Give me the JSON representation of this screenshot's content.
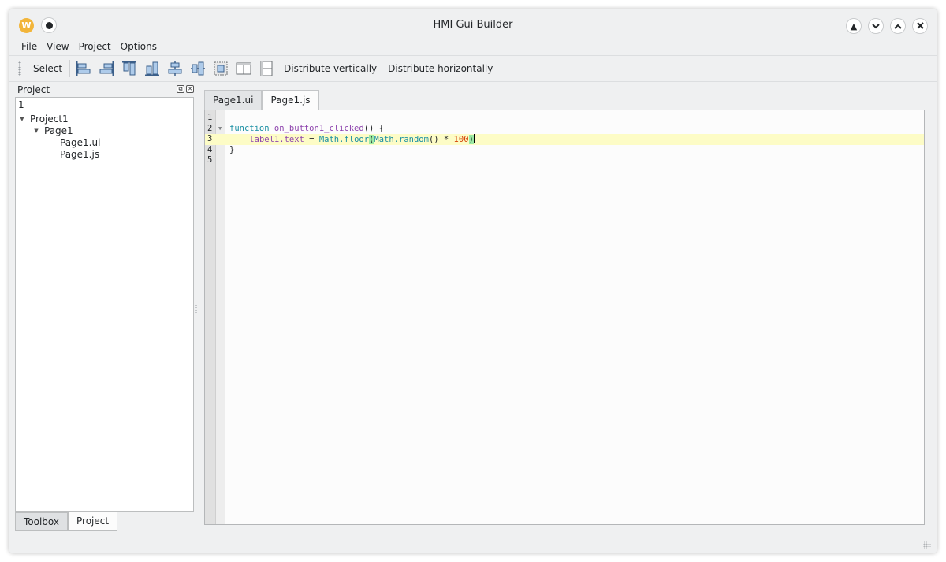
{
  "window": {
    "title": "HMI Gui Builder",
    "logo_letter": "W"
  },
  "menubar": {
    "items": [
      "File",
      "View",
      "Project",
      "Options"
    ]
  },
  "toolbar": {
    "select_label": "Select",
    "icons": [
      "align-left-icon",
      "align-right-icon",
      "align-top-icon",
      "align-bottom-icon",
      "align-center-vertical-icon",
      "align-center-horizontal-icon",
      "same-height-icon",
      "same-width-icon",
      "same-size-icon"
    ],
    "distribute_vertically_label": "Distribute vertically",
    "distribute_horizontally_label": "Distribute horizontally"
  },
  "project_panel": {
    "title": "Project",
    "filter_value": "1",
    "tree": [
      {
        "label": "Project1",
        "level": 0,
        "expanded": true
      },
      {
        "label": "Page1",
        "level": 1,
        "expanded": true
      },
      {
        "label": "Page1.ui",
        "level": 2
      },
      {
        "label": "Page1.js",
        "level": 2
      }
    ],
    "bottom_tabs": [
      "Toolbox",
      "Project"
    ],
    "active_bottom_tab": "Project"
  },
  "editor": {
    "tabs": [
      "Page1.ui",
      "Page1.js"
    ],
    "active_tab": "Page1.js",
    "line_numbers": [
      "1",
      "2",
      "3",
      "4",
      "5"
    ],
    "code": {
      "line2_kw": "function",
      "line2_name": "on_button1_clicked",
      "line2_rest": "() {",
      "line3_obj": "label1.text",
      "line3_eq": " = ",
      "line3_math1": "Math",
      "line3_floor": ".floor",
      "line3_paren_open": "(",
      "line3_math2": "Math",
      "line3_random": ".random",
      "line3_mid": "() * ",
      "line3_num": "100",
      "line3_paren_close": ")",
      "line4": "}"
    },
    "current_line": 3
  },
  "colors": {
    "keyword": "#1a8fa3",
    "function_name": "#8e44ad",
    "number": "#d4460a",
    "current_line": "#fdfcc6",
    "brace_match": "#9ceaa4",
    "window_bg": "#eff0f1"
  }
}
